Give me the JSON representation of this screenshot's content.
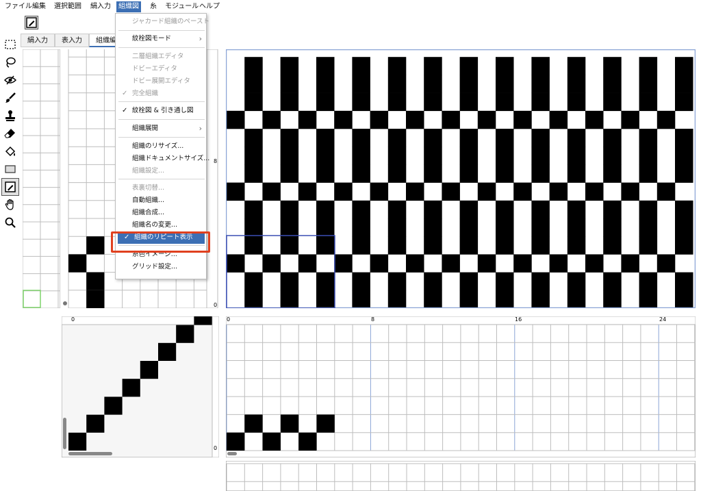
{
  "menubar": {
    "items": [
      "ファイル",
      "編集",
      "選択範囲",
      "絹入力",
      "組織図",
      "糸",
      "モジュール",
      "ヘルプ"
    ],
    "active_index": 4
  },
  "tabs": [
    "絹入力",
    "表入力",
    "組織編"
  ],
  "tools": [
    "rect-select-icon",
    "lasso-icon",
    "eye-icon",
    "brush-icon",
    "stamp-icon",
    "eraser-icon",
    "fill-icon",
    "rectangle-icon",
    "pen-tool-icon",
    "hand-icon",
    "zoom-icon"
  ],
  "dropdown": {
    "items": [
      {
        "label": "ジャカード組織のペースト",
        "disabled": true
      },
      {
        "label": "紋栓図モード",
        "submenu": true
      },
      {
        "label": "二層組織エディタ",
        "disabled": true
      },
      {
        "label": "ドビーエディタ",
        "disabled": true
      },
      {
        "label": "ドビー展開エディタ",
        "disabled": true
      },
      {
        "label": "完全組織",
        "disabled": true,
        "checked": true
      },
      {
        "label": "紋栓図 & 引き通し図",
        "checked": true
      },
      {
        "label": "組織展開",
        "submenu": true
      },
      {
        "label": "組織のリサイズ..."
      },
      {
        "label": "組織ドキュメントサイズ..."
      },
      {
        "label": "組織設定...",
        "disabled": true
      },
      {
        "label": "表裏切替...",
        "disabled": true
      },
      {
        "label": "自動組織..."
      },
      {
        "label": "組織合成..."
      },
      {
        "label": "組織名の変更..."
      },
      {
        "label": "組織のリピート表示",
        "checked": true,
        "highlighted": true
      },
      {
        "label": "糸色イメージ..."
      },
      {
        "label": "グリッド設定..."
      }
    ]
  },
  "rulers": {
    "main_right": [
      "8",
      "0"
    ],
    "bottom_top": [
      "0",
      "8",
      "16",
      "24"
    ],
    "bottom_left_top": [
      "0"
    ],
    "bottom_left_bottom": [
      "0"
    ]
  },
  "colors": {
    "accent": "#3c6fb4",
    "highlight_border": "#e0401f",
    "grid_line": "#bdbdbd",
    "cell_fill": "#000000"
  }
}
